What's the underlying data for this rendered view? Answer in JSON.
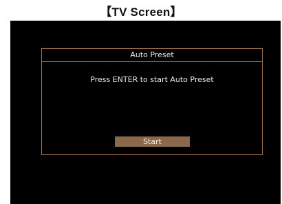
{
  "caption": "【TV Screen】",
  "dialog": {
    "title": "Auto Preset",
    "message": "Press ENTER to start Auto Preset",
    "start_label": "Start"
  },
  "colors": {
    "screen_background": "#000000",
    "frame_border": "#9c7550",
    "button_background": "#8a6849",
    "text": "#e8e8e8"
  }
}
